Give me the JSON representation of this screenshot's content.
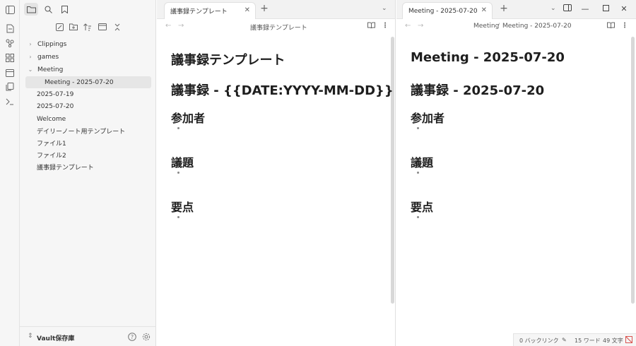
{
  "sidebar": {
    "tree": [
      {
        "label": "Clippings",
        "chevron": "›"
      },
      {
        "label": "games",
        "chevron": "›"
      },
      {
        "label": "Meeting",
        "chevron": "⌄"
      },
      {
        "label": "Meeting - 2025-07-20"
      },
      {
        "label": "2025-07-19"
      },
      {
        "label": "2025-07-20"
      },
      {
        "label": "Welcome"
      },
      {
        "label": "デイリーノート用テンプレート"
      },
      {
        "label": "ファイル1"
      },
      {
        "label": "ファイル2"
      },
      {
        "label": "議事録テンプレート"
      }
    ],
    "vault_name": "Vault保存庫"
  },
  "left_pane": {
    "tab_title": "議事録テンプレート",
    "nav_title": "議事録テンプレート",
    "file_title": "議事録テンプレート",
    "h1": "議事録 - {{DATE:YYYY-MM-DD}}",
    "sections": [
      "参加者",
      "議題",
      "要点"
    ]
  },
  "right_pane": {
    "tab_title": "Meeting - 2025-07-20",
    "breadcrumb_folder": "Meeting",
    "breadcrumb_sep": "/",
    "breadcrumb_file": "Meeting - 2025-07-20",
    "file_title": "Meeting - 2025-07-20",
    "h1": "議事録 - 2025-07-20",
    "sections": [
      "参加者",
      "議題",
      "要点"
    ]
  },
  "status_bar": {
    "backlinks": "0 バックリンク",
    "words": "15 ワード",
    "chars": "49 文字"
  },
  "colors": {
    "sidebar_bg": "#f6f6f6",
    "selected_bg": "#e6e6e6",
    "accent_sync_error": "#d9534f"
  }
}
